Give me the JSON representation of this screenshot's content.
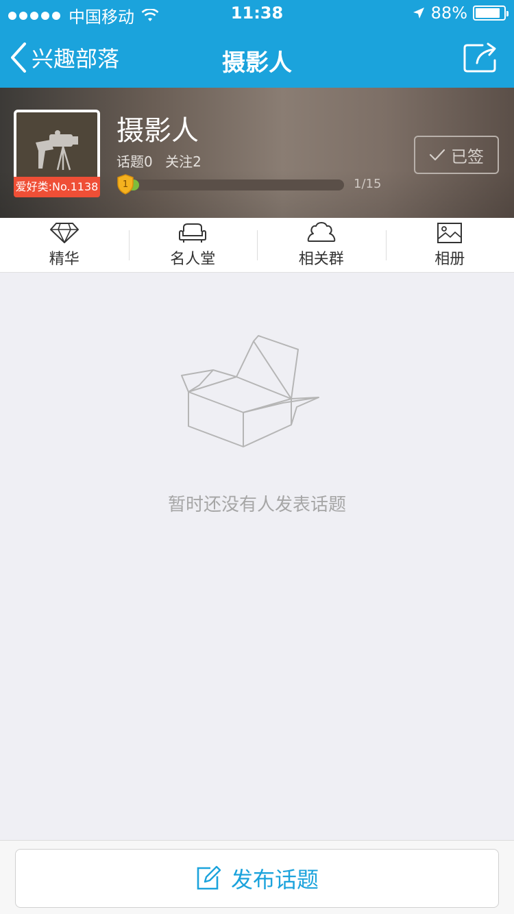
{
  "status_bar": {
    "carrier": "中国移动",
    "time": "11:38",
    "battery": "88%",
    "battery_level": 0.88
  },
  "nav": {
    "back_label": "兴趣部落",
    "title": "摄影人"
  },
  "group": {
    "name": "摄影人",
    "topics": "话题0",
    "followers": "关注2",
    "rank_badge": "爱好类:No.1138",
    "level": "1",
    "level_progress_text": "1/15",
    "level_progress": 0.0667,
    "signed_label": "已签"
  },
  "tabs": [
    {
      "label": "精华",
      "icon": "diamond-icon"
    },
    {
      "label": "名人堂",
      "icon": "sofa-icon"
    },
    {
      "label": "相关群",
      "icon": "group-icon"
    },
    {
      "label": "相册",
      "icon": "photo-icon"
    }
  ],
  "empty_state": {
    "message": "暂时还没有人发表话题"
  },
  "bottom": {
    "post_label": "发布话题"
  },
  "colors": {
    "primary": "#1ba3dc",
    "badge": "#ef4f36",
    "level_fill": "#7dbd3c"
  }
}
